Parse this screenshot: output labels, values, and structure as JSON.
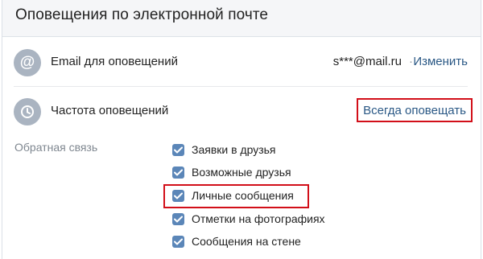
{
  "header": {
    "title": "Оповещения по электронной почте"
  },
  "email_row": {
    "icon": "at-sign-icon",
    "label": "Email для оповещений",
    "value": "s***@mail.ru",
    "separator": "·",
    "action": "Изменить"
  },
  "frequency_row": {
    "icon": "clock-icon",
    "label": "Частота оповещений",
    "value": "Всегда оповещать"
  },
  "feedback": {
    "label": "Обратная связь",
    "items": [
      {
        "label": "Заявки в друзья",
        "checked": true
      },
      {
        "label": "Возможные друзья",
        "checked": true
      },
      {
        "label": "Личные сообщения",
        "checked": true
      },
      {
        "label": "Отметки на фотографиях",
        "checked": true
      },
      {
        "label": "Сообщения на стене",
        "checked": true
      }
    ]
  },
  "colors": {
    "link": "#2a5885",
    "checkbox": "#5b86b8",
    "highlight": "#d20f19",
    "icon_bg": "#aab4c1"
  }
}
